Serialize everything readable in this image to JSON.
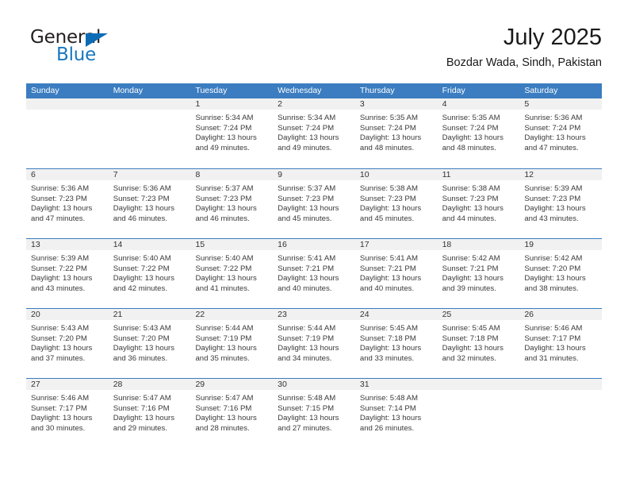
{
  "brand": {
    "word1": "General",
    "word2": "Blue",
    "triangle_color": "#0b6cb5",
    "word2_color": "#1878be"
  },
  "header": {
    "title": "July 2025",
    "subtitle": "Bozdar Wada, Sindh, Pakistan"
  },
  "theme": {
    "header_blue": "#3b7dc0",
    "day_band_gray": "#f1f1f1",
    "text": "#3a3a3a"
  },
  "calendar": {
    "weekdays": [
      "Sunday",
      "Monday",
      "Tuesday",
      "Wednesday",
      "Thursday",
      "Friday",
      "Saturday"
    ],
    "weeks": [
      [
        {
          "day": "",
          "lines": []
        },
        {
          "day": "",
          "lines": []
        },
        {
          "day": "1",
          "lines": [
            "Sunrise: 5:34 AM",
            "Sunset: 7:24 PM",
            "Daylight: 13 hours and 49 minutes."
          ]
        },
        {
          "day": "2",
          "lines": [
            "Sunrise: 5:34 AM",
            "Sunset: 7:24 PM",
            "Daylight: 13 hours and 49 minutes."
          ]
        },
        {
          "day": "3",
          "lines": [
            "Sunrise: 5:35 AM",
            "Sunset: 7:24 PM",
            "Daylight: 13 hours and 48 minutes."
          ]
        },
        {
          "day": "4",
          "lines": [
            "Sunrise: 5:35 AM",
            "Sunset: 7:24 PM",
            "Daylight: 13 hours and 48 minutes."
          ]
        },
        {
          "day": "5",
          "lines": [
            "Sunrise: 5:36 AM",
            "Sunset: 7:24 PM",
            "Daylight: 13 hours and 47 minutes."
          ]
        }
      ],
      [
        {
          "day": "6",
          "lines": [
            "Sunrise: 5:36 AM",
            "Sunset: 7:23 PM",
            "Daylight: 13 hours and 47 minutes."
          ]
        },
        {
          "day": "7",
          "lines": [
            "Sunrise: 5:36 AM",
            "Sunset: 7:23 PM",
            "Daylight: 13 hours and 46 minutes."
          ]
        },
        {
          "day": "8",
          "lines": [
            "Sunrise: 5:37 AM",
            "Sunset: 7:23 PM",
            "Daylight: 13 hours and 46 minutes."
          ]
        },
        {
          "day": "9",
          "lines": [
            "Sunrise: 5:37 AM",
            "Sunset: 7:23 PM",
            "Daylight: 13 hours and 45 minutes."
          ]
        },
        {
          "day": "10",
          "lines": [
            "Sunrise: 5:38 AM",
            "Sunset: 7:23 PM",
            "Daylight: 13 hours and 45 minutes."
          ]
        },
        {
          "day": "11",
          "lines": [
            "Sunrise: 5:38 AM",
            "Sunset: 7:23 PM",
            "Daylight: 13 hours and 44 minutes."
          ]
        },
        {
          "day": "12",
          "lines": [
            "Sunrise: 5:39 AM",
            "Sunset: 7:23 PM",
            "Daylight: 13 hours and 43 minutes."
          ]
        }
      ],
      [
        {
          "day": "13",
          "lines": [
            "Sunrise: 5:39 AM",
            "Sunset: 7:22 PM",
            "Daylight: 13 hours and 43 minutes."
          ]
        },
        {
          "day": "14",
          "lines": [
            "Sunrise: 5:40 AM",
            "Sunset: 7:22 PM",
            "Daylight: 13 hours and 42 minutes."
          ]
        },
        {
          "day": "15",
          "lines": [
            "Sunrise: 5:40 AM",
            "Sunset: 7:22 PM",
            "Daylight: 13 hours and 41 minutes."
          ]
        },
        {
          "day": "16",
          "lines": [
            "Sunrise: 5:41 AM",
            "Sunset: 7:21 PM",
            "Daylight: 13 hours and 40 minutes."
          ]
        },
        {
          "day": "17",
          "lines": [
            "Sunrise: 5:41 AM",
            "Sunset: 7:21 PM",
            "Daylight: 13 hours and 40 minutes."
          ]
        },
        {
          "day": "18",
          "lines": [
            "Sunrise: 5:42 AM",
            "Sunset: 7:21 PM",
            "Daylight: 13 hours and 39 minutes."
          ]
        },
        {
          "day": "19",
          "lines": [
            "Sunrise: 5:42 AM",
            "Sunset: 7:20 PM",
            "Daylight: 13 hours and 38 minutes."
          ]
        }
      ],
      [
        {
          "day": "20",
          "lines": [
            "Sunrise: 5:43 AM",
            "Sunset: 7:20 PM",
            "Daylight: 13 hours and 37 minutes."
          ]
        },
        {
          "day": "21",
          "lines": [
            "Sunrise: 5:43 AM",
            "Sunset: 7:20 PM",
            "Daylight: 13 hours and 36 minutes."
          ]
        },
        {
          "day": "22",
          "lines": [
            "Sunrise: 5:44 AM",
            "Sunset: 7:19 PM",
            "Daylight: 13 hours and 35 minutes."
          ]
        },
        {
          "day": "23",
          "lines": [
            "Sunrise: 5:44 AM",
            "Sunset: 7:19 PM",
            "Daylight: 13 hours and 34 minutes."
          ]
        },
        {
          "day": "24",
          "lines": [
            "Sunrise: 5:45 AM",
            "Sunset: 7:18 PM",
            "Daylight: 13 hours and 33 minutes."
          ]
        },
        {
          "day": "25",
          "lines": [
            "Sunrise: 5:45 AM",
            "Sunset: 7:18 PM",
            "Daylight: 13 hours and 32 minutes."
          ]
        },
        {
          "day": "26",
          "lines": [
            "Sunrise: 5:46 AM",
            "Sunset: 7:17 PM",
            "Daylight: 13 hours and 31 minutes."
          ]
        }
      ],
      [
        {
          "day": "27",
          "lines": [
            "Sunrise: 5:46 AM",
            "Sunset: 7:17 PM",
            "Daylight: 13 hours and 30 minutes."
          ]
        },
        {
          "day": "28",
          "lines": [
            "Sunrise: 5:47 AM",
            "Sunset: 7:16 PM",
            "Daylight: 13 hours and 29 minutes."
          ]
        },
        {
          "day": "29",
          "lines": [
            "Sunrise: 5:47 AM",
            "Sunset: 7:16 PM",
            "Daylight: 13 hours and 28 minutes."
          ]
        },
        {
          "day": "30",
          "lines": [
            "Sunrise: 5:48 AM",
            "Sunset: 7:15 PM",
            "Daylight: 13 hours and 27 minutes."
          ]
        },
        {
          "day": "31",
          "lines": [
            "Sunrise: 5:48 AM",
            "Sunset: 7:14 PM",
            "Daylight: 13 hours and 26 minutes."
          ]
        },
        {
          "day": "",
          "lines": []
        },
        {
          "day": "",
          "lines": []
        }
      ]
    ]
  }
}
